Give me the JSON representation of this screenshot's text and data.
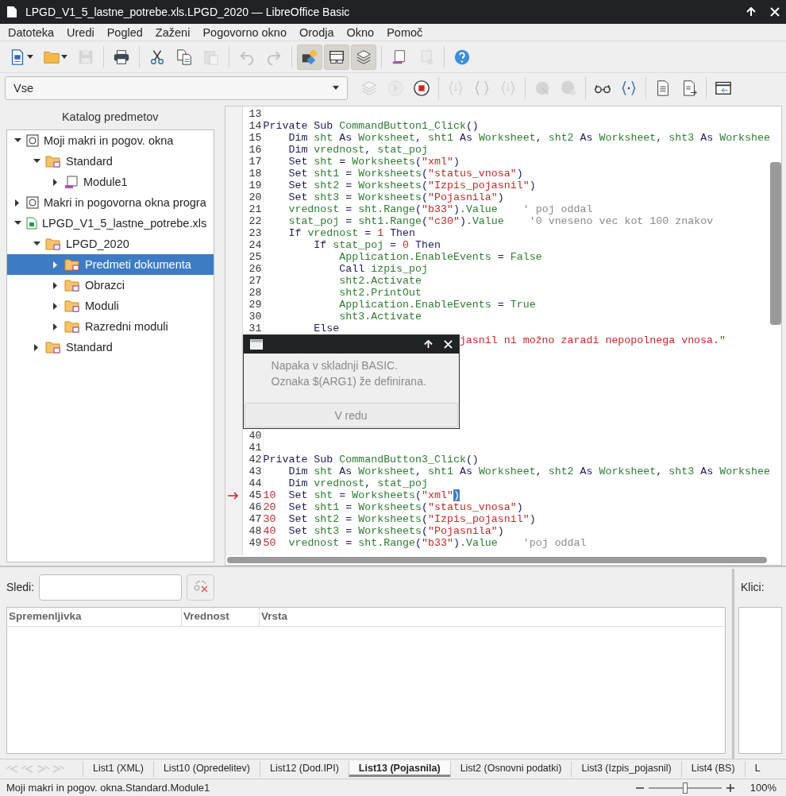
{
  "window": {
    "title": "LPGD_V1_5_lastne_potrebe.xls.LPGD_2020 — LibreOffice Basic"
  },
  "menu": [
    "Datoteka",
    "Uredi",
    "Pogled",
    "Zaženi",
    "Pogovorno okno",
    "Orodja",
    "Okno",
    "Pomoč"
  ],
  "toolbar": {
    "buttons": [
      {
        "disabled": false,
        "pressed": false
      },
      {
        "disabled": false,
        "pressed": false
      },
      {
        "disabled": true,
        "pressed": false
      },
      {
        "disabled": false,
        "pressed": false
      },
      {
        "disabled": false,
        "pressed": false
      },
      {
        "disabled": false,
        "pressed": false
      },
      {
        "disabled": true,
        "pressed": false
      },
      {
        "disabled": true,
        "pressed": false
      },
      {
        "disabled": true,
        "pressed": false
      },
      {
        "disabled": false,
        "pressed": true
      },
      {
        "disabled": false,
        "pressed": true
      },
      {
        "disabled": false,
        "pressed": true
      },
      {
        "disabled": false,
        "pressed": false
      },
      {
        "disabled": true,
        "pressed": false
      },
      {
        "disabled": false,
        "pressed": false
      }
    ]
  },
  "macro_toolbar": {
    "library_select": {
      "value": "Vse"
    },
    "buttons": [
      {
        "disabled": true
      },
      {
        "disabled": true
      },
      {
        "disabled": false
      },
      {
        "disabled": true
      },
      {
        "disabled": true
      },
      {
        "disabled": true
      },
      {
        "disabled": true
      },
      {
        "disabled": true
      },
      {
        "disabled": false
      },
      {
        "disabled": false
      },
      {
        "disabled": false
      },
      {
        "disabled": false
      },
      {
        "disabled": false
      }
    ]
  },
  "object_catalog": {
    "title": "Katalog predmetov",
    "tree": [
      {
        "label": "Moji makri in pogov. okna",
        "kind": "library",
        "expanded": true,
        "selected": false,
        "children": [
          {
            "label": "Standard",
            "kind": "folder",
            "expanded": true,
            "selected": false,
            "children": [
              {
                "label": "Module1",
                "kind": "module",
                "expanded": false,
                "selected": false
              }
            ]
          }
        ]
      },
      {
        "label": "Makri in pogovorna okna progra",
        "kind": "library",
        "expanded": false,
        "selected": false
      },
      {
        "label": "LPGD_V1_5_lastne_potrebe.xls",
        "kind": "document",
        "expanded": true,
        "selected": false,
        "children": [
          {
            "label": "LPGD_2020",
            "kind": "folder",
            "expanded": true,
            "selected": false,
            "children": [
              {
                "label": "Predmeti dokumenta",
                "kind": "folder",
                "expanded": false,
                "selected": true
              },
              {
                "label": "Obrazci",
                "kind": "folder",
                "expanded": false,
                "selected": false
              },
              {
                "label": "Moduli",
                "kind": "folder",
                "expanded": false,
                "selected": false
              },
              {
                "label": "Razredni moduli",
                "kind": "folder",
                "expanded": false,
                "selected": false
              }
            ]
          },
          {
            "label": "Standard",
            "kind": "folder",
            "expanded": false,
            "selected": false
          }
        ]
      }
    ]
  },
  "editor": {
    "lines": [
      {
        "num": "13"
      },
      {
        "num": "14",
        "tokens": [
          {
            "kind": "keyword",
            "text": "Private Sub "
          },
          {
            "kind": "identifier",
            "text": "CommandButton1_Click"
          },
          {
            "kind": "keyword",
            "text": "()"
          }
        ]
      },
      {
        "num": "15",
        "tokens": [
          {
            "kind": "keyword",
            "text": "    Dim "
          },
          {
            "kind": "identifier",
            "text": "sht"
          },
          {
            "kind": "keyword",
            "text": " As "
          },
          {
            "kind": "identifier",
            "text": "Worksheet"
          },
          {
            "kind": "keyword",
            "text": ", "
          },
          {
            "kind": "identifier",
            "text": "sht1"
          },
          {
            "kind": "keyword",
            "text": " As "
          },
          {
            "kind": "identifier",
            "text": "Worksheet"
          },
          {
            "kind": "keyword",
            "text": ", "
          },
          {
            "kind": "identifier",
            "text": "sht2"
          },
          {
            "kind": "keyword",
            "text": " As "
          },
          {
            "kind": "identifier",
            "text": "Worksheet"
          },
          {
            "kind": "keyword",
            "text": ", "
          },
          {
            "kind": "identifier",
            "text": "sht3"
          },
          {
            "kind": "keyword",
            "text": " As "
          },
          {
            "kind": "identifier",
            "text": "Workshee"
          }
        ]
      },
      {
        "num": "16",
        "tokens": [
          {
            "kind": "keyword",
            "text": "    Dim "
          },
          {
            "kind": "identifier",
            "text": "vrednost"
          },
          {
            "kind": "keyword",
            "text": ", "
          },
          {
            "kind": "identifier",
            "text": "stat_poj"
          }
        ]
      },
      {
        "num": "17",
        "tokens": [
          {
            "kind": "keyword",
            "text": "    Set "
          },
          {
            "kind": "identifier",
            "text": "sht"
          },
          {
            "kind": "keyword",
            "text": " = "
          },
          {
            "kind": "identifier",
            "text": "Worksheets"
          },
          {
            "kind": "keyword",
            "text": "("
          },
          {
            "kind": "string",
            "text": "\"xml\""
          },
          {
            "kind": "keyword",
            "text": ")"
          }
        ]
      },
      {
        "num": "18",
        "tokens": [
          {
            "kind": "keyword",
            "text": "    Set "
          },
          {
            "kind": "identifier",
            "text": "sht1"
          },
          {
            "kind": "keyword",
            "text": " = "
          },
          {
            "kind": "identifier",
            "text": "Worksheets"
          },
          {
            "kind": "keyword",
            "text": "("
          },
          {
            "kind": "string",
            "text": "\"status_vnosa\""
          },
          {
            "kind": "keyword",
            "text": ")"
          }
        ]
      },
      {
        "num": "19",
        "tokens": [
          {
            "kind": "keyword",
            "text": "    Set "
          },
          {
            "kind": "identifier",
            "text": "sht2"
          },
          {
            "kind": "keyword",
            "text": " = "
          },
          {
            "kind": "identifier",
            "text": "Worksheets"
          },
          {
            "kind": "keyword",
            "text": "("
          },
          {
            "kind": "string",
            "text": "\"Izpis_pojasnil\""
          },
          {
            "kind": "keyword",
            "text": ")"
          }
        ]
      },
      {
        "num": "20",
        "tokens": [
          {
            "kind": "keyword",
            "text": "    Set "
          },
          {
            "kind": "identifier",
            "text": "sht3"
          },
          {
            "kind": "keyword",
            "text": " = "
          },
          {
            "kind": "identifier",
            "text": "Worksheets"
          },
          {
            "kind": "keyword",
            "text": "("
          },
          {
            "kind": "string",
            "text": "\"Pojasnila\""
          },
          {
            "kind": "keyword",
            "text": ")"
          }
        ]
      },
      {
        "num": "21",
        "tokens": [
          {
            "kind": "identifier",
            "text": "    vrednost"
          },
          {
            "kind": "keyword",
            "text": " = "
          },
          {
            "kind": "identifier",
            "text": "sht.Range"
          },
          {
            "kind": "keyword",
            "text": "("
          },
          {
            "kind": "string",
            "text": "\"b33\""
          },
          {
            "kind": "keyword",
            "text": ")"
          },
          {
            "kind": "identifier",
            "text": ".Value"
          },
          {
            "kind": "comment",
            "text": "    ' poj oddal"
          }
        ]
      },
      {
        "num": "22",
        "tokens": [
          {
            "kind": "identifier",
            "text": "    stat_poj"
          },
          {
            "kind": "keyword",
            "text": " = "
          },
          {
            "kind": "identifier",
            "text": "sht1.Range"
          },
          {
            "kind": "keyword",
            "text": "("
          },
          {
            "kind": "string",
            "text": "\"c30\""
          },
          {
            "kind": "keyword",
            "text": ")"
          },
          {
            "kind": "identifier",
            "text": ".Value"
          },
          {
            "kind": "comment",
            "text": "    '0 vneseno vec kot 100 znakov"
          }
        ]
      },
      {
        "num": "23",
        "tokens": [
          {
            "kind": "keyword",
            "text": "    If "
          },
          {
            "kind": "identifier",
            "text": "vrednost"
          },
          {
            "kind": "keyword",
            "text": " = "
          },
          {
            "kind": "number",
            "text": "1"
          },
          {
            "kind": "keyword",
            "text": " Then"
          }
        ]
      },
      {
        "num": "24",
        "tokens": [
          {
            "kind": "keyword",
            "text": "        If "
          },
          {
            "kind": "identifier",
            "text": "stat_poj"
          },
          {
            "kind": "keyword",
            "text": " = "
          },
          {
            "kind": "number",
            "text": "0"
          },
          {
            "kind": "keyword",
            "text": " Then"
          }
        ]
      },
      {
        "num": "25",
        "tokens": [
          {
            "kind": "identifier",
            "text": "            Application.EnableEvents"
          },
          {
            "kind": "keyword",
            "text": " = "
          },
          {
            "kind": "identifier",
            "text": "False"
          }
        ]
      },
      {
        "num": "26",
        "tokens": [
          {
            "kind": "keyword",
            "text": "            Call "
          },
          {
            "kind": "identifier",
            "text": "izpis_poj"
          }
        ]
      },
      {
        "num": "27",
        "tokens": [
          {
            "kind": "identifier",
            "text": "            sht2.Activate"
          }
        ]
      },
      {
        "num": "28",
        "tokens": [
          {
            "kind": "identifier",
            "text": "            sht2.PrintOut"
          }
        ]
      },
      {
        "num": "29",
        "tokens": [
          {
            "kind": "identifier",
            "text": "            Application.EnableEvents"
          },
          {
            "kind": "keyword",
            "text": " = "
          },
          {
            "kind": "identifier",
            "text": "True"
          }
        ]
      },
      {
        "num": "30",
        "tokens": [
          {
            "kind": "identifier",
            "text": "            sht3.Activate"
          }
        ]
      },
      {
        "num": "31",
        "tokens": [
          {
            "kind": "keyword",
            "text": "        Else"
          }
        ]
      },
      {
        "kind": "covered",
        "tokens": [
          {
            "kind": "string",
            "text": "jasnil ni možno zaradi nepopolnega vnosa.\""
          }
        ]
      },
      {
        "num": "40"
      },
      {
        "num": "41"
      },
      {
        "num": "42",
        "tokens": [
          {
            "kind": "keyword",
            "text": "Private Sub "
          },
          {
            "kind": "identifier",
            "text": "CommandButton3_Click"
          },
          {
            "kind": "keyword",
            "text": "()"
          }
        ]
      },
      {
        "num": "43",
        "tokens": [
          {
            "kind": "keyword",
            "text": "    Dim "
          },
          {
            "kind": "identifier",
            "text": "sht"
          },
          {
            "kind": "keyword",
            "text": " As "
          },
          {
            "kind": "identifier",
            "text": "Worksheet"
          },
          {
            "kind": "keyword",
            "text": ", "
          },
          {
            "kind": "identifier",
            "text": "sht1"
          },
          {
            "kind": "keyword",
            "text": " As "
          },
          {
            "kind": "identifier",
            "text": "Worksheet"
          },
          {
            "kind": "keyword",
            "text": ", "
          },
          {
            "kind": "identifier",
            "text": "sht2"
          },
          {
            "kind": "keyword",
            "text": " As "
          },
          {
            "kind": "identifier",
            "text": "Worksheet"
          },
          {
            "kind": "keyword",
            "text": ", "
          },
          {
            "kind": "identifier",
            "text": "sht3"
          },
          {
            "kind": "keyword",
            "text": " As "
          },
          {
            "kind": "identifier",
            "text": "Workshee"
          }
        ]
      },
      {
        "num": "44",
        "tokens": [
          {
            "kind": "keyword",
            "text": "    Dim "
          },
          {
            "kind": "identifier",
            "text": "vrednost"
          },
          {
            "kind": "keyword",
            "text": ", "
          },
          {
            "kind": "identifier",
            "text": "stat_poj"
          }
        ]
      },
      {
        "num": "45",
        "current": true,
        "tokens": [
          {
            "kind": "number",
            "text": "10"
          },
          {
            "kind": "keyword",
            "text": "  Set "
          },
          {
            "kind": "identifier",
            "text": "sht"
          },
          {
            "kind": "keyword",
            "text": " = "
          },
          {
            "kind": "identifier",
            "text": "Worksheets"
          },
          {
            "kind": "keyword",
            "text": "("
          },
          {
            "kind": "string",
            "text": "\"xml\""
          },
          {
            "kind": "selection",
            "text": ")"
          }
        ]
      },
      {
        "num": "46",
        "tokens": [
          {
            "kind": "number",
            "text": "20"
          },
          {
            "kind": "keyword",
            "text": "  Set "
          },
          {
            "kind": "identifier",
            "text": "sht1"
          },
          {
            "kind": "keyword",
            "text": " = "
          },
          {
            "kind": "identifier",
            "text": "Worksheets"
          },
          {
            "kind": "keyword",
            "text": "("
          },
          {
            "kind": "string",
            "text": "\"status_vnosa\""
          },
          {
            "kind": "keyword",
            "text": ")"
          }
        ]
      },
      {
        "num": "47",
        "tokens": [
          {
            "kind": "number",
            "text": "30"
          },
          {
            "kind": "keyword",
            "text": "  Set "
          },
          {
            "kind": "identifier",
            "text": "sht2"
          },
          {
            "kind": "keyword",
            "text": " = "
          },
          {
            "kind": "identifier",
            "text": "Worksheets"
          },
          {
            "kind": "keyword",
            "text": "("
          },
          {
            "kind": "string",
            "text": "\"Izpis_pojasnil\""
          },
          {
            "kind": "keyword",
            "text": ")"
          }
        ]
      },
      {
        "num": "48",
        "tokens": [
          {
            "kind": "number",
            "text": "40"
          },
          {
            "kind": "keyword",
            "text": "  Set "
          },
          {
            "kind": "identifier",
            "text": "sht3"
          },
          {
            "kind": "keyword",
            "text": " = "
          },
          {
            "kind": "identifier",
            "text": "Worksheets"
          },
          {
            "kind": "keyword",
            "text": "("
          },
          {
            "kind": "string",
            "text": "\"Pojasnila\""
          },
          {
            "kind": "keyword",
            "text": ")"
          }
        ]
      },
      {
        "num": "49",
        "tokens": [
          {
            "kind": "number",
            "text": "50"
          },
          {
            "kind": "identifier",
            "text": "  vrednost"
          },
          {
            "kind": "keyword",
            "text": " = "
          },
          {
            "kind": "identifier",
            "text": "sht.Range"
          },
          {
            "kind": "keyword",
            "text": "("
          },
          {
            "kind": "string",
            "text": "\"b33\""
          },
          {
            "kind": "keyword",
            "text": ")"
          },
          {
            "kind": "identifier",
            "text": ".Value"
          },
          {
            "kind": "comment",
            "text": "    'poj oddal"
          }
        ]
      }
    ]
  },
  "dialog": {
    "message": [
      "Napaka v skladnji BASIC.",
      "Oznaka $(ARG1) že definirana."
    ],
    "button": "V redu"
  },
  "watch": {
    "label": "Sledi:",
    "columns": [
      "Spremenljivka",
      "Vrednost",
      "Vrsta"
    ]
  },
  "calls": {
    "label": "Klici:"
  },
  "sheet_tabs": [
    {
      "label": "List1 (XML)",
      "selected": false
    },
    {
      "label": "List10 (Opredelitev)",
      "selected": false
    },
    {
      "label": "List12 (Dod.IPI)",
      "selected": false
    },
    {
      "label": "List13 (Pojasnila)",
      "selected": true
    },
    {
      "label": "List2 (Osnovni podatki)",
      "selected": false
    },
    {
      "label": "List3 (Izpis_pojasnil)",
      "selected": false
    },
    {
      "label": "List4 (BS)",
      "selected": false
    },
    {
      "label": "L",
      "selected": false
    }
  ],
  "status_bar": {
    "location": "Moji makri in pogov. okna.Standard.Module1",
    "zoom": {
      "level": 0.5,
      "reading": "100%"
    }
  }
}
